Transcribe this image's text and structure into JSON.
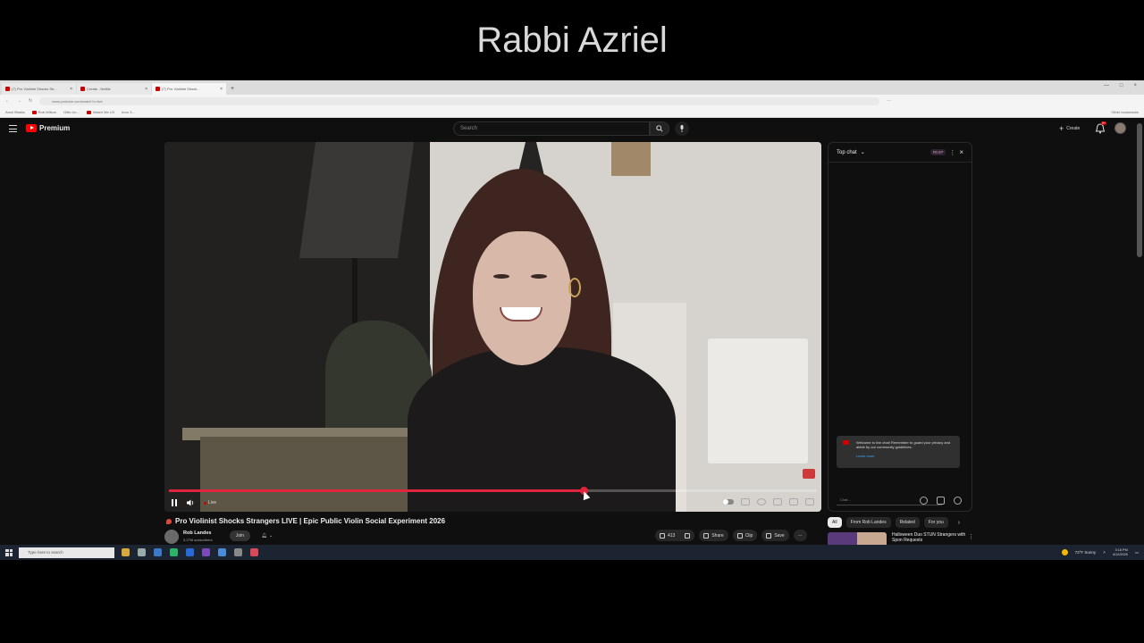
{
  "caption": {
    "text": "Rabbi Azriel"
  },
  "browser": {
    "tabs": [
      {
        "label": "(7) Pro Violinist Shocks Str...",
        "active": false
      },
      {
        "label": "Create - Netflix",
        "active": false
      },
      {
        "label": "(7) Pro Violinist Shock...",
        "active": true
      }
    ],
    "new_tab": "+",
    "url": "www.youtube.com/watch?v=live",
    "bookmarks": [
      "Amol Bhatia",
      "Rob Wilson",
      "Gifts Un...",
      "Watch Me U3",
      "Arvo 3..."
    ],
    "bookmarks_right": "Other bookmarks"
  },
  "youtube": {
    "logo_text": "Premium",
    "search_placeholder": "Search",
    "create_label": "Create",
    "notification_count": "9+"
  },
  "player": {
    "progress": 0.64,
    "live_label": "Live"
  },
  "chat": {
    "header": "Top chat",
    "header_badge": "FEXP",
    "notice": "Welcome to live chat! Remember to guard your privacy and abide by our community guidelines.",
    "learn_more": "Learn more",
    "input_placeholder": "Chat..."
  },
  "video": {
    "title": "Pro Violinist Shocks Strangers LIVE | Epic Public Violin Social Experiment 2026",
    "channel_name": "Rob Landes",
    "subscribers": "3.27M subscribers",
    "join_label": "Join",
    "likes": "413",
    "share_label": "Share",
    "clip_label": "Clip",
    "save_label": "Save"
  },
  "recommendations": {
    "chips": [
      "All",
      "From Rob Landes",
      "Related",
      "For you"
    ],
    "first_title": "Halloween Duo STUN Strangers with Spon Requests"
  },
  "taskbar": {
    "search_placeholder": "Type here to search",
    "weather": "73°F Sunny",
    "time": "3:18 PM",
    "date": "4/12/2026"
  }
}
